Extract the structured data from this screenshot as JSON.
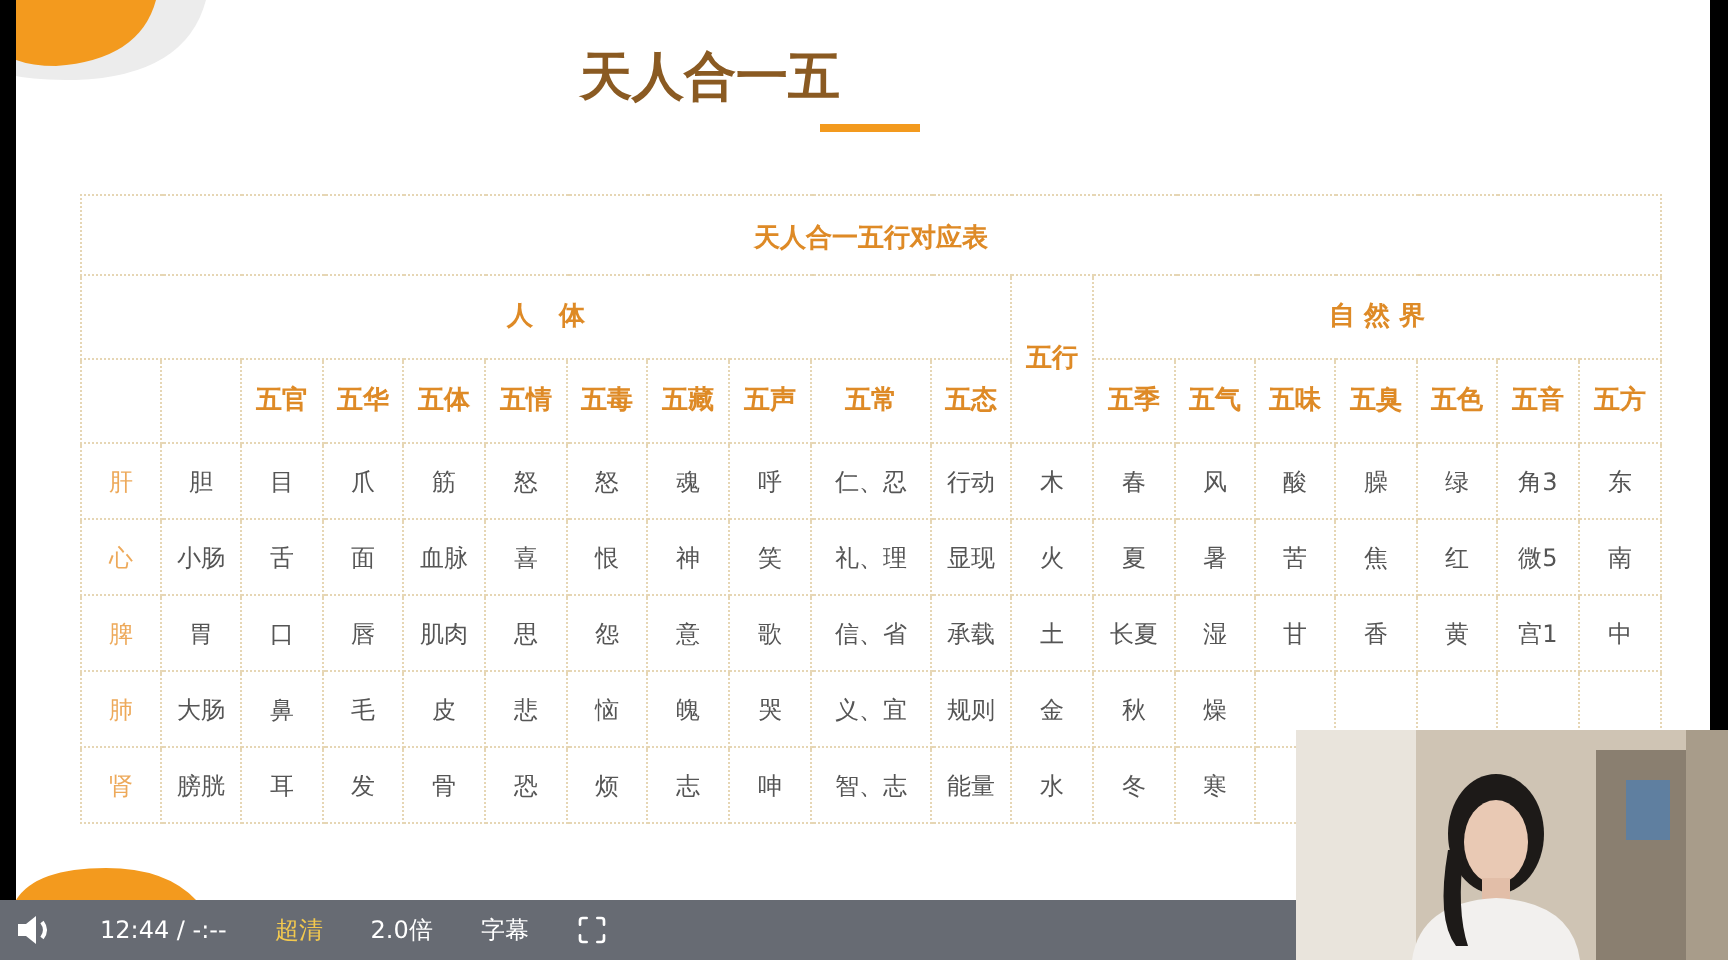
{
  "slide": {
    "title": "天人合一五",
    "table": {
      "caption": "天人合一五行对应表",
      "body_group": "人　体",
      "element_header": "五行",
      "nature_group": "自 然 界",
      "body_headers": [
        "五官",
        "五华",
        "五体",
        "五情",
        "五毒",
        "五藏",
        "五声",
        "五常",
        "五态"
      ],
      "nature_headers": [
        "五季",
        "五气",
        "五味",
        "五臭",
        "五色",
        "五音",
        "五方"
      ],
      "rows": [
        {
          "organ": "肝",
          "cells": [
            "胆",
            "目",
            "爪",
            "筋",
            "怒",
            "怒",
            "魂",
            "呼",
            "仁、忍",
            "行动",
            "木",
            "春",
            "风",
            "酸",
            "臊",
            "绿",
            "角3",
            "东"
          ]
        },
        {
          "organ": "心",
          "cells": [
            "小肠",
            "舌",
            "面",
            "血脉",
            "喜",
            "恨",
            "神",
            "笑",
            "礼、理",
            "显现",
            "火",
            "夏",
            "暑",
            "苦",
            "焦",
            "红",
            "微5",
            "南"
          ]
        },
        {
          "organ": "脾",
          "cells": [
            "胃",
            "口",
            "唇",
            "肌肉",
            "思",
            "怨",
            "意",
            "歌",
            "信、省",
            "承载",
            "土",
            "长夏",
            "湿",
            "甘",
            "香",
            "黄",
            "宫1",
            "中"
          ]
        },
        {
          "organ": "肺",
          "cells": [
            "大肠",
            "鼻",
            "毛",
            "皮",
            "悲",
            "恼",
            "魄",
            "哭",
            "义、宜",
            "规则",
            "金",
            "秋",
            "燥"
          ]
        },
        {
          "organ": "肾",
          "cells": [
            "膀胱",
            "耳",
            "发",
            "骨",
            "恐",
            "烦",
            "志",
            "呻",
            "智、志",
            "能量",
            "水",
            "冬",
            "寒"
          ]
        }
      ]
    }
  },
  "controls": {
    "time": "12:44 / -:--",
    "quality": "超清",
    "speed": "2.0倍",
    "subtitles": "字幕"
  }
}
